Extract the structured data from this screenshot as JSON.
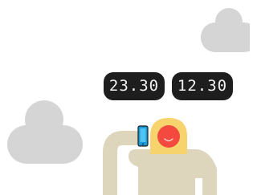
{
  "readouts": {
    "left": "23.30",
    "right": "12.30"
  },
  "colors": {
    "background": "#ffffff",
    "cloud": "#d5d5d5",
    "readout_bg": "#1e1e1e",
    "readout_text": "#f2f2f2",
    "body": "#ddd6bd",
    "head": "#f7d36e",
    "face": "#f4493f",
    "phone": "#1a9bd7"
  },
  "icons": [
    "cloud-icon",
    "phone-icon",
    "smile-icon"
  ]
}
